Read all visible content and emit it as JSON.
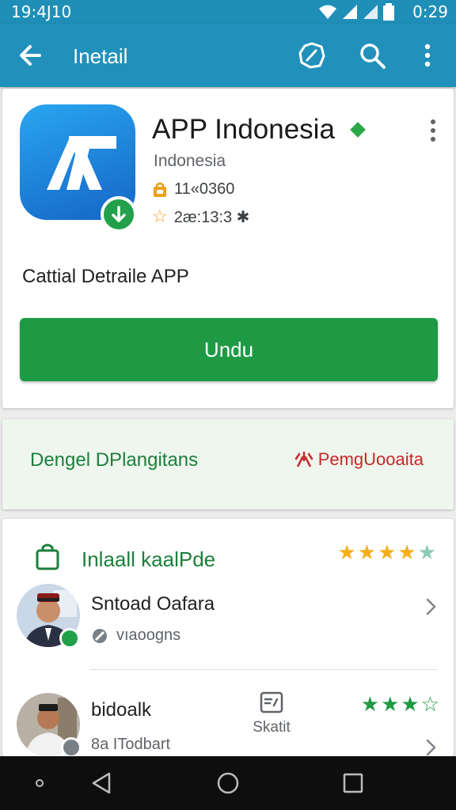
{
  "status_bar": {
    "time": "19:4J10",
    "clock": "0:29"
  },
  "app_bar": {
    "title": "Inetail"
  },
  "app": {
    "title": "APP Indonesia",
    "publisher": "Indonesia",
    "downloads": "11«0360",
    "rating": "2æ:13:3 ✱",
    "description": "Cattial Detraile APP",
    "install_label": "Undu",
    "colors": {
      "accent": "#1e9a45",
      "app_bar": "#2191bb",
      "icon": "#1f80df"
    }
  },
  "promo": {
    "left_text": "Dengel DPlangitans",
    "right_text": "PemgUooaita"
  },
  "reviews": {
    "title": "Inlaall kaalPde",
    "rating_stars": 4.5,
    "items": [
      {
        "name": "Sntoad Oafara",
        "meta": "vıaoogns"
      },
      {
        "name": "bidoalk",
        "meta": "8a ITodbart",
        "stat_label": "Skatit",
        "rating_stars": 3.5
      }
    ]
  }
}
